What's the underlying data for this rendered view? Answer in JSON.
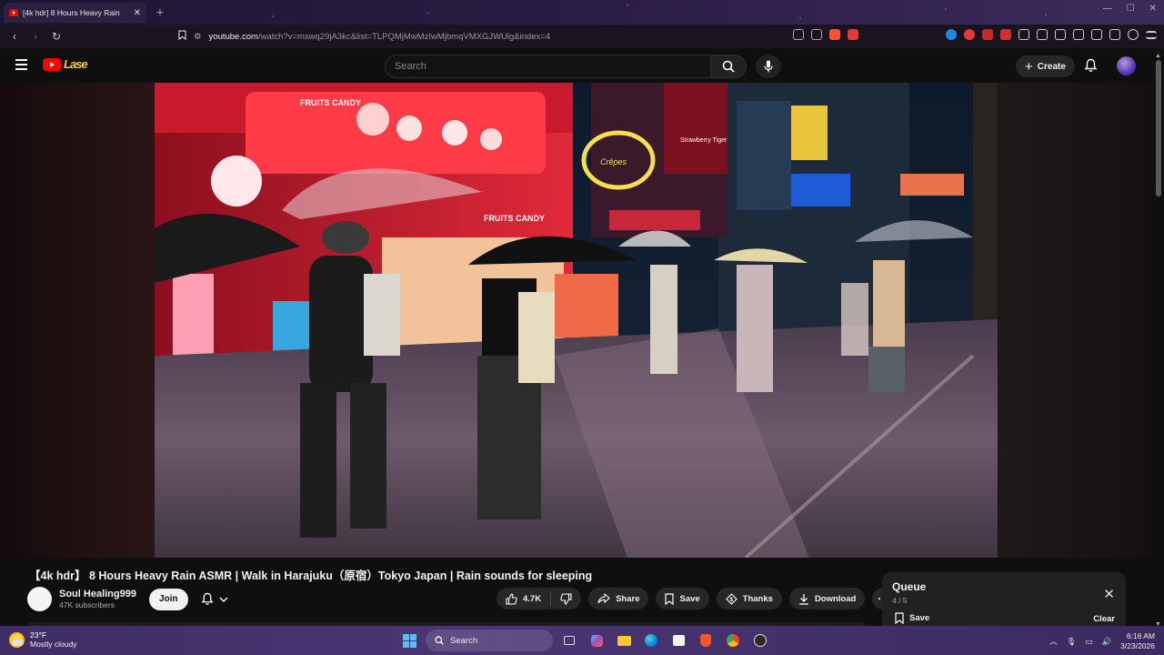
{
  "browser": {
    "tab_title": "[4k hdr] 8 Hours Heavy Rain",
    "url_domain": "youtube.com",
    "url_path": "/watch?v=mswq29jA3kc&list=TLPQMjMwMzIwMjbmqVMXGJWUlg&index=4"
  },
  "youtube": {
    "search_placeholder": "Search",
    "create_label": "Create",
    "logo_doodle": "Lase"
  },
  "video": {
    "title": "【4k hdr】 8 Hours Heavy Rain ASMR | Walk in Harajuku（原宿）Tokyo Japan | Rain sounds for sleeping",
    "scene_texts": {
      "sign1": "FRUITS CANDY",
      "sign2": "FRUITS CANDY",
      "sign3": "Strawberry Tiger",
      "sign4": "Crêpes"
    }
  },
  "channel": {
    "name": "Soul Healing999",
    "subscribers": "47K subscribers",
    "join_label": "Join"
  },
  "actions": {
    "likes": "4.7K",
    "share": "Share",
    "save": "Save",
    "thanks": "Thanks",
    "download": "Download"
  },
  "queue": {
    "title": "Queue",
    "count": "4 / 5",
    "save_label": "Save",
    "clear_label": "Clear"
  },
  "taskbar": {
    "temperature": "23°F",
    "weather": "Mostly cloudy",
    "search_label": "Search",
    "time": "6:16 AM",
    "date": "3/23/2026"
  },
  "colors": {
    "yt_red": "#ff0000",
    "bg": "#0f0f0f",
    "taskbar": "#4a3673"
  }
}
